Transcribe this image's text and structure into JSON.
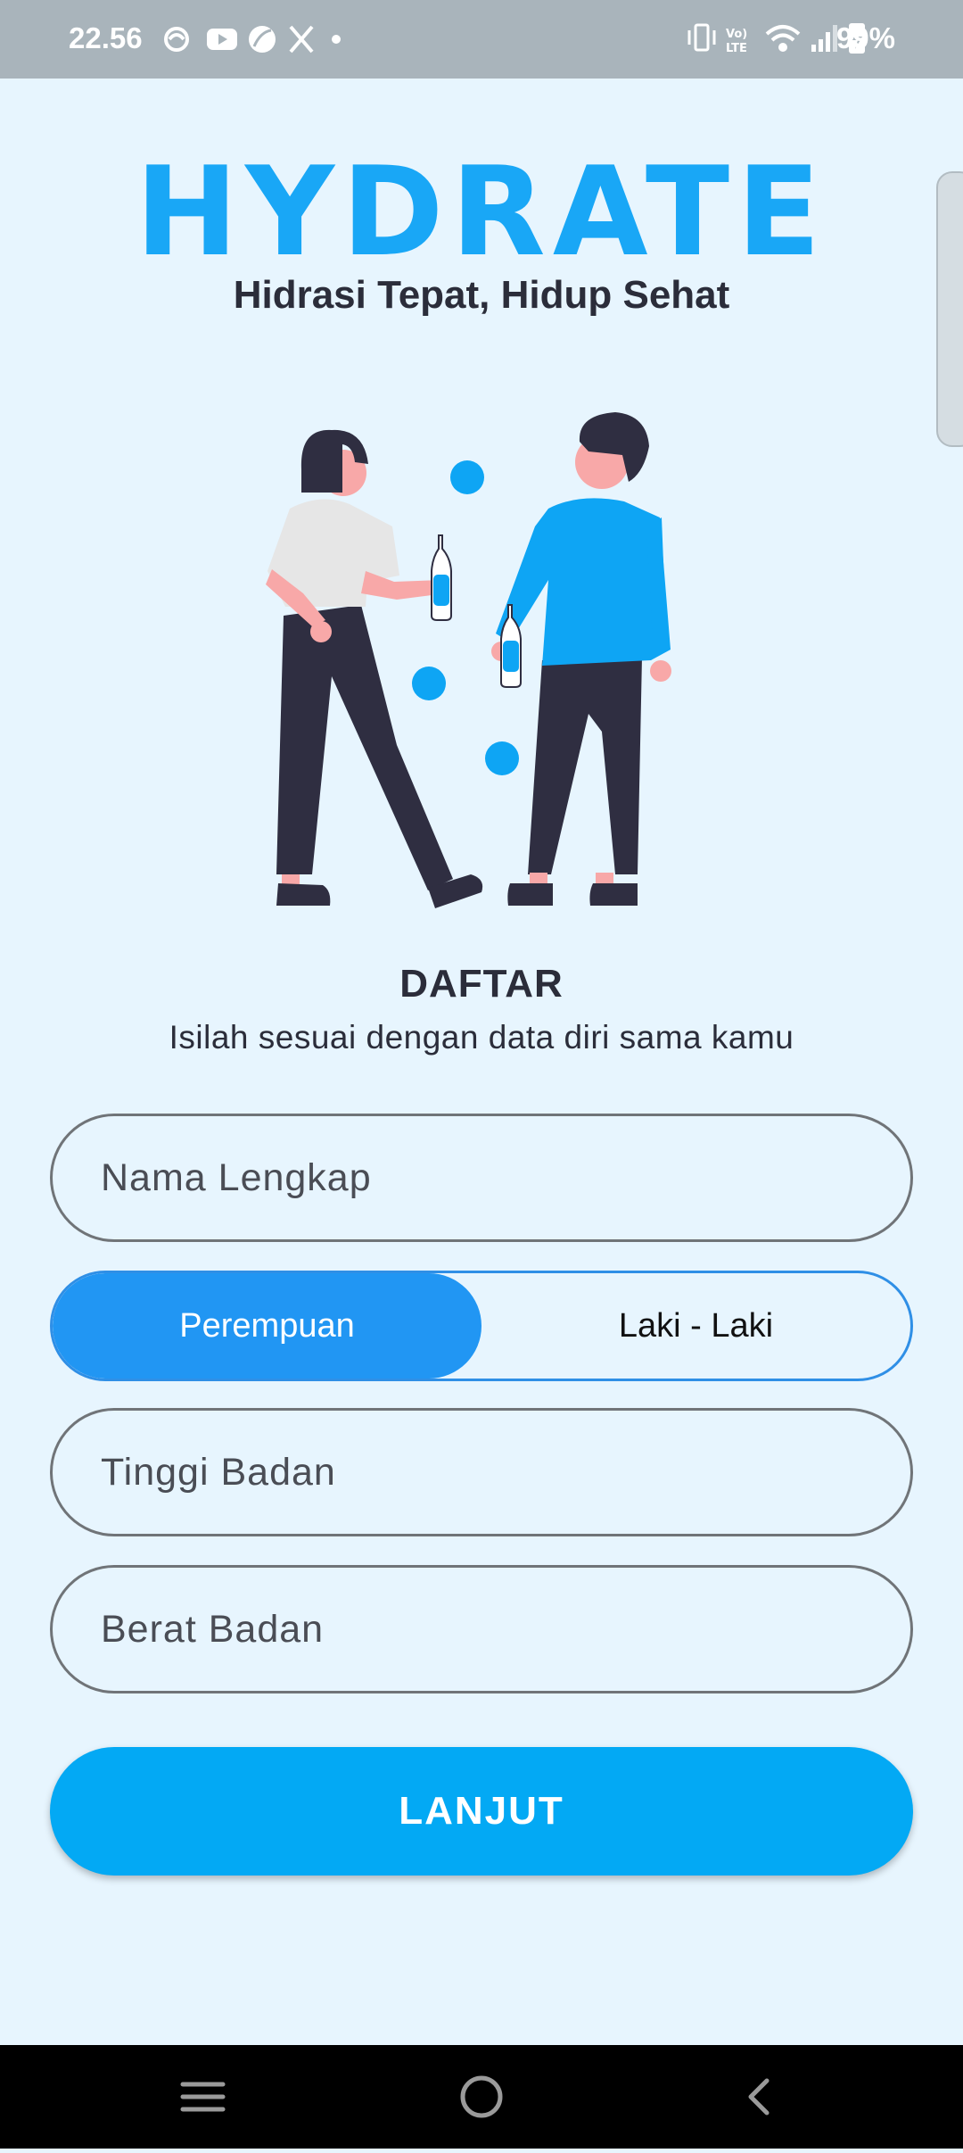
{
  "status": {
    "time": "22.56",
    "battery": "99%"
  },
  "app": {
    "logo": "HYDRATE",
    "tagline": "Hidrasi Tepat, Hidup Sehat"
  },
  "form": {
    "title": "DAFTAR",
    "subtitle": "Isilah sesuai dengan data diri sama kamu",
    "name_placeholder": "Nama Lengkap",
    "gender": {
      "options": [
        "Perempuan",
        "Laki - Laki"
      ],
      "selected": "Perempuan"
    },
    "height_placeholder": "Tinggi Badan",
    "weight_placeholder": "Berat Badan",
    "submit_label": "LANJUT"
  },
  "colors": {
    "accent": "#19a7f6",
    "button": "#03a9f4",
    "toggle_active": "#2196f3",
    "background": "#e7f5fe"
  },
  "icons": {
    "status_left": [
      "pregnancy-app-icon",
      "youtube-icon",
      "leaf-app-icon",
      "x-icon",
      "dot-icon"
    ],
    "status_right": [
      "vibrate-icon",
      "volte-icon",
      "wifi-icon",
      "signal-icon",
      "battery-charging-icon"
    ],
    "nav": [
      "menu-icon",
      "home-icon",
      "back-icon"
    ]
  }
}
